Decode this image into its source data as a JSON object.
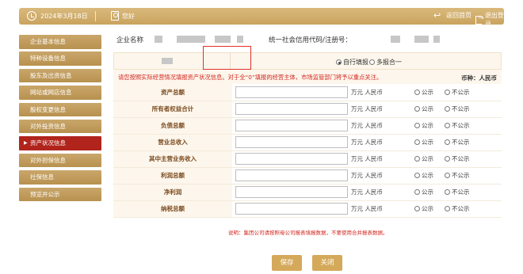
{
  "header": {
    "date": "2024年3月18日",
    "greeting": "您好",
    "home_label": "返回首页",
    "logout_label": "退出登录"
  },
  "sidebar": {
    "items": [
      {
        "label": "企业基本信息",
        "active": false
      },
      {
        "label": "特种设备信息",
        "active": false
      },
      {
        "label": "股东及出资信息",
        "active": false
      },
      {
        "label": "网站或网店信息",
        "active": false
      },
      {
        "label": "股权变更信息",
        "active": false
      },
      {
        "label": "对外投资信息",
        "active": false
      },
      {
        "label": "资产状况信息",
        "active": true
      },
      {
        "label": "对外担保信息",
        "active": false
      },
      {
        "label": "社保信息",
        "active": false
      },
      {
        "label": "预览并公示",
        "active": false
      }
    ]
  },
  "company": {
    "name_label": "企业名称",
    "code_label": "统一社会信用代码/注册号："
  },
  "filltype": {
    "self_label": "自行填报",
    "merge_label": "多报合一",
    "selected": "self"
  },
  "notice": {
    "text": "请您按照实际经营情况填报资产状况信息。对于全“0”填报的经营主体，市场监管部门将予以重点关注。",
    "currency": "币种：人民币"
  },
  "assets": {
    "unit": "万元 人民币",
    "public_label": "公示",
    "private_label": "不公示",
    "rows": [
      {
        "label": "资产总额"
      },
      {
        "label": "所有者权益合计"
      },
      {
        "label": "负债总额"
      },
      {
        "label": "营业总收入"
      },
      {
        "label": "其中主营业务收入"
      },
      {
        "label": "利润总额"
      },
      {
        "label": "净利润"
      },
      {
        "label": "纳税总额"
      }
    ]
  },
  "footnote": "说明：集团公司请按照母公司报表填报数据，不要使用合并报表数据。",
  "buttons": {
    "save": "保存",
    "close": "关闭"
  },
  "colors": {
    "gold": "#c9a35e",
    "active_red": "#b1241c",
    "notice_red": "#d2271f"
  }
}
